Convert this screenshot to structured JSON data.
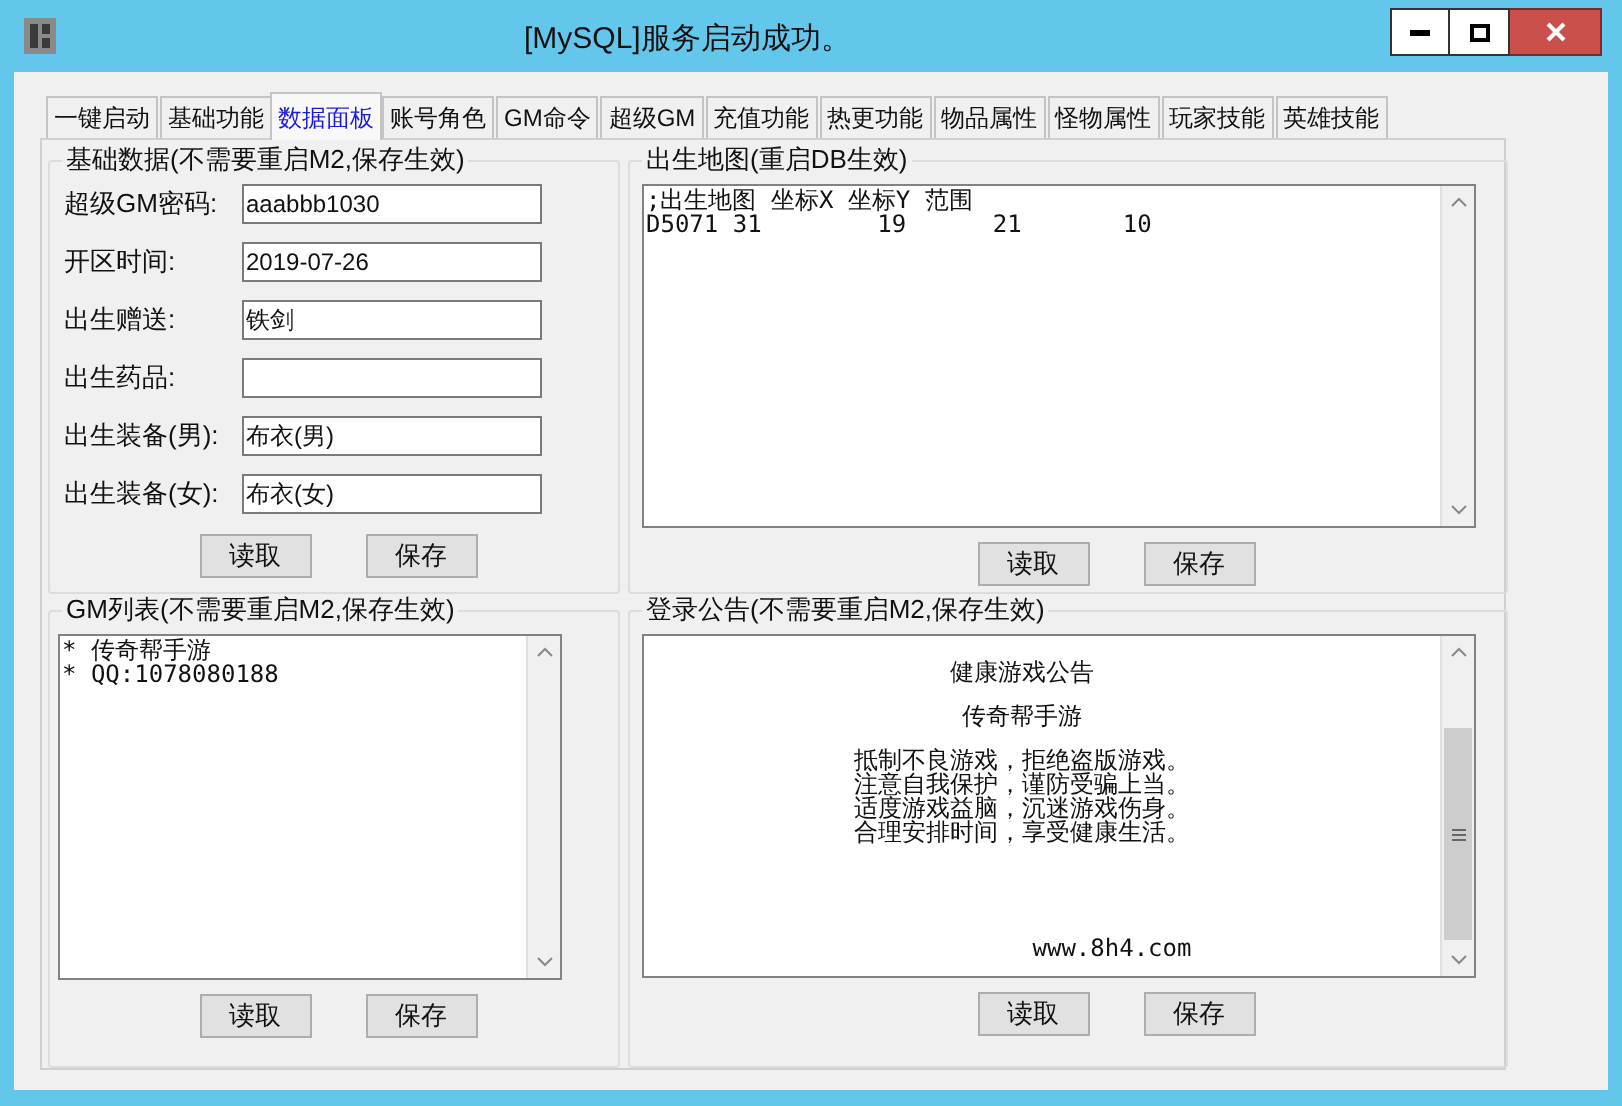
{
  "window": {
    "title": "[MySQL]服务启动成功。"
  },
  "tabs": [
    {
      "label": "一键启动",
      "selected": false
    },
    {
      "label": "基础功能",
      "selected": false
    },
    {
      "label": "数据面板",
      "selected": true
    },
    {
      "label": "账号角色",
      "selected": false
    },
    {
      "label": "GM命令",
      "selected": false
    },
    {
      "label": "超级GM",
      "selected": false
    },
    {
      "label": "充值功能",
      "selected": false
    },
    {
      "label": "热更功能",
      "selected": false
    },
    {
      "label": "物品属性",
      "selected": false
    },
    {
      "label": "怪物属性",
      "selected": false
    },
    {
      "label": "玩家技能",
      "selected": false
    },
    {
      "label": "英雄技能",
      "selected": false
    }
  ],
  "panels": [
    {
      "kind": "form",
      "title": "基础数据(不需要重启M2,保存生效)",
      "fields": [
        {
          "label": "超级GM密码:",
          "value": "aaabbb1030"
        },
        {
          "label": "开区时间:",
          "value": "2019-07-26"
        },
        {
          "label": "出生赠送:",
          "value": "铁剑"
        },
        {
          "label": "出生药品:"
        },
        {
          "label": "出生装备(男):",
          "value": "布衣(男)"
        },
        {
          "label": "出生装备(女):",
          "value": "布衣(女)"
        }
      ],
      "buttons": [
        "读取",
        "保存"
      ]
    },
    {
      "kind": "text",
      "title": "出生地图(重启DB生效)",
      "paragraphs": [
        [
          ";出生地图 坐标X 坐标Y 范围",
          "D5071 31        19      21       10"
        ]
      ],
      "buttons": [
        "读取",
        "保存"
      ]
    },
    {
      "kind": "text",
      "title": "GM列表(不需要重启M2,保存生效)",
      "paragraphs": [
        [
          "* 传奇帮手游",
          "* QQ:1078080188"
        ]
      ],
      "buttons": [
        "读取",
        "保存"
      ]
    },
    {
      "kind": "notice",
      "title": "登录公告(不需要重启M2,保存生效)",
      "paragraphs": [
        [
          "健康游戏公告"
        ],
        [
          "传奇帮手游"
        ],
        [
          "抵制不良游戏，拒绝盗版游戏。",
          "注意自我保护，谨防受骗上当。",
          "适度游戏益脑，沉迷游戏伤身。",
          "合理安排时间，享受健康生活。"
        ],
        [
          "www.8h4.com"
        ]
      ],
      "buttons": [
        "读取",
        "保存"
      ]
    }
  ]
}
